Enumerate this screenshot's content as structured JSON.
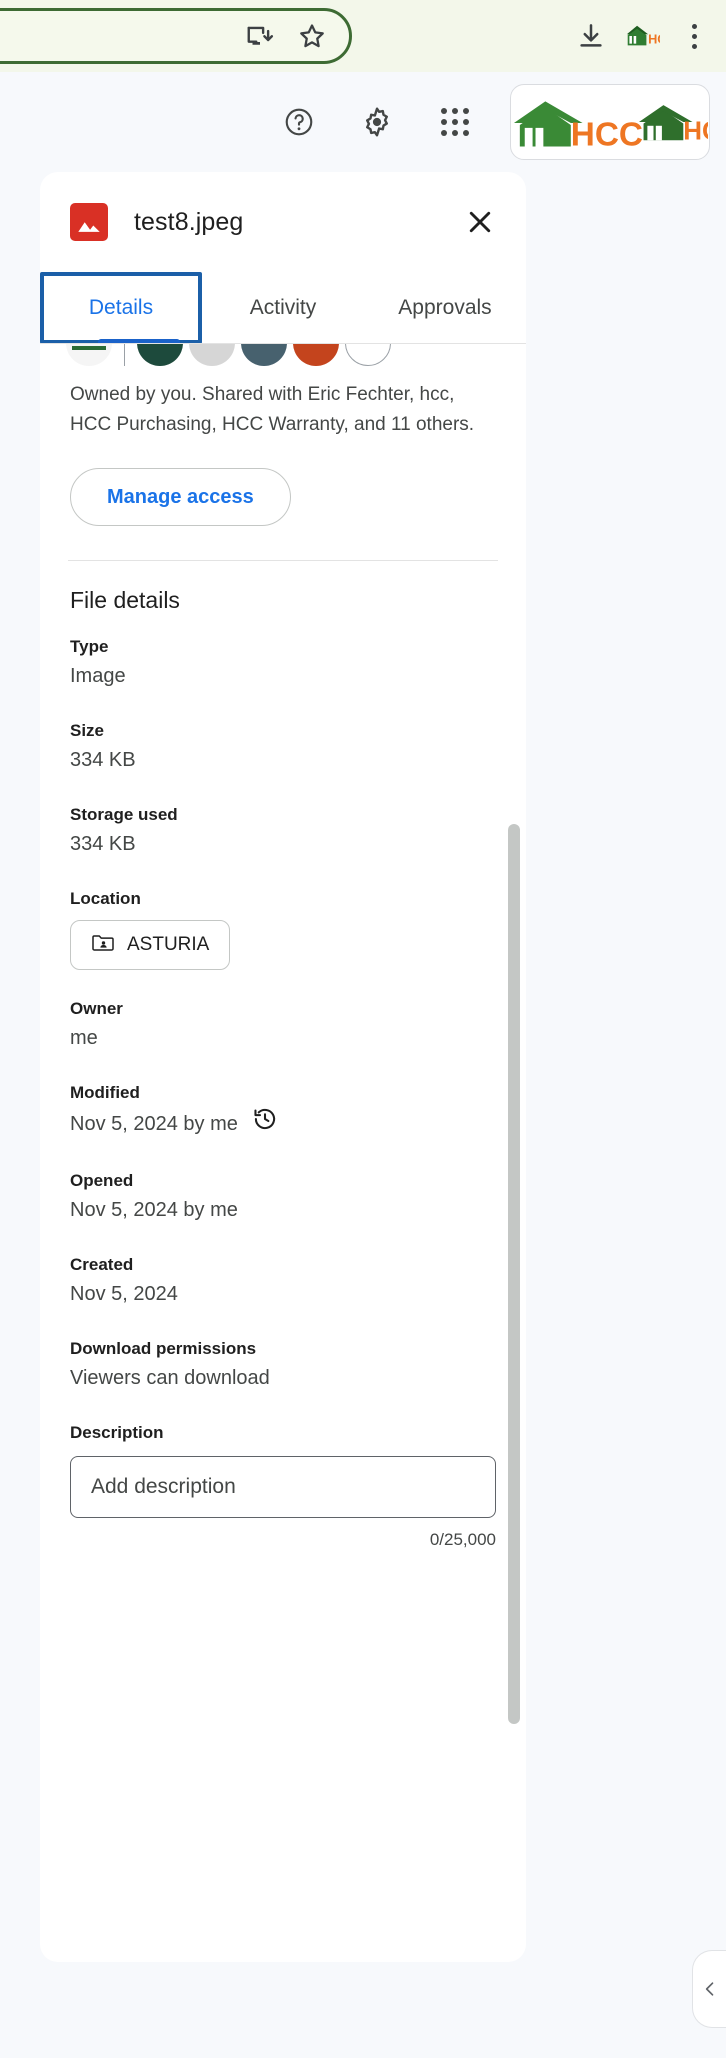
{
  "browser": {
    "cast_icon": "cast-icon",
    "bookmark_icon": "star-icon",
    "download_icon": "download-icon",
    "extension_icon": "hcc-extension-icon",
    "menu_icon": "kebab-menu-icon"
  },
  "drive_toolbar": {
    "help_icon": "help-icon",
    "settings_icon": "gear-icon",
    "apps_icon": "apps-grid-icon",
    "account_logo": "hcc-account-logo"
  },
  "panel": {
    "file_icon": "image-file-icon",
    "file_name": "test8.jpeg",
    "close_icon": "close-icon",
    "tabs": [
      {
        "label": "Details",
        "active": true,
        "focused": true
      },
      {
        "label": "Activity",
        "active": false,
        "focused": false
      },
      {
        "label": "Approvals",
        "active": false,
        "focused": false
      }
    ],
    "sharing": {
      "avatars": [
        {
          "name": "avatar-me",
          "color": "#f5f5f5"
        },
        {
          "name": "avatar-dark-green",
          "color": "#1d4a3c"
        },
        {
          "name": "avatar-light-gray",
          "color": "#d6d6d6"
        },
        {
          "name": "avatar-slate",
          "color": "#47616e"
        },
        {
          "name": "avatar-orange-red",
          "color": "#c4441d"
        },
        {
          "name": "avatar-overflow",
          "color": "#ffffff"
        }
      ],
      "summary": "Owned by you. Shared with Eric Fechter, hcc, HCC Purchasing, HCC Warranty, and 11 others.",
      "manage_access_label": "Manage access"
    },
    "file_details": {
      "heading": "File details",
      "fields": [
        {
          "label": "Type",
          "value": "Image",
          "kind": "text"
        },
        {
          "label": "Size",
          "value": "334 KB",
          "kind": "text"
        },
        {
          "label": "Storage used",
          "value": "334 KB",
          "kind": "text"
        },
        {
          "label": "Location",
          "value": "ASTURIA",
          "kind": "chip",
          "icon": "shared-folder-icon"
        },
        {
          "label": "Owner",
          "value": "me",
          "kind": "text"
        },
        {
          "label": "Modified",
          "value": "Nov 5, 2024 by me",
          "kind": "text-with-icon",
          "icon": "version-history-icon"
        },
        {
          "label": "Opened",
          "value": "Nov 5, 2024 by me",
          "kind": "text"
        },
        {
          "label": "Created",
          "value": "Nov 5, 2024",
          "kind": "text"
        },
        {
          "label": "Download permissions",
          "value": "Viewers can download",
          "kind": "text"
        }
      ],
      "description": {
        "label": "Description",
        "placeholder": "Add description",
        "value": "",
        "counter": "0/25,000"
      }
    },
    "collapse_icon": "chevron-left-icon"
  },
  "colors": {
    "accent_blue": "#1a73e8",
    "focus_blue": "#1b5fa8",
    "brand_green": "#3d6b33",
    "brand_orange": "#ee7623",
    "file_red": "#d93025"
  }
}
